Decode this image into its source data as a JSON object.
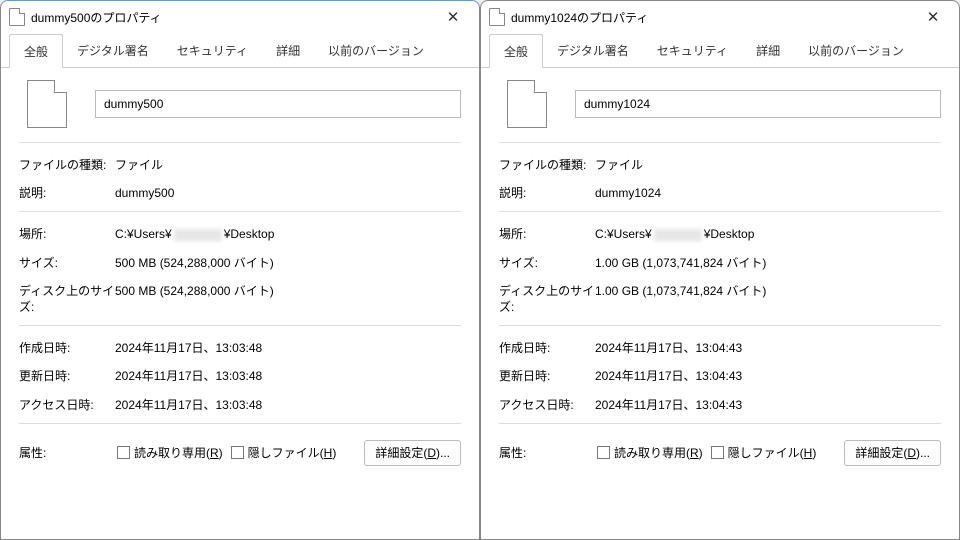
{
  "tabs": {
    "general": "全般",
    "signature": "デジタル署名",
    "security": "セキュリティ",
    "details": "詳細",
    "previous": "以前のバージョン"
  },
  "labels": {
    "filetype": "ファイルの種類:",
    "description": "説明:",
    "location": "場所:",
    "size": "サイズ:",
    "sizeondisk": "ディスク上のサイズ:",
    "created": "作成日時:",
    "modified": "更新日時:",
    "accessed": "アクセス日時:",
    "attributes": "属性:",
    "readonly_pre": "読み取り専用(",
    "readonly_u": "R",
    "readonly_post": ")",
    "hidden_pre": "隠しファイル(",
    "hidden_u": "H",
    "hidden_post": ")",
    "advanced_pre": "詳細設定(",
    "advanced_u": "D",
    "advanced_post": ")..."
  },
  "left": {
    "title": "dummy500のプロパティ",
    "name": "dummy500",
    "filetype": "ファイル",
    "description": "dummy500",
    "location_pre": "C:¥Users¥",
    "location_post": "¥Desktop",
    "size": "500 MB (524,288,000 バイト)",
    "sizeondisk": "500 MB (524,288,000 バイト)",
    "created": "2024年11月17日、13:03:48",
    "modified": "2024年11月17日、13:03:48",
    "accessed": "2024年11月17日、13:03:48"
  },
  "right": {
    "title": "dummy1024のプロパティ",
    "name": "dummy1024",
    "filetype": "ファイル",
    "description": "dummy1024",
    "location_pre": "C:¥Users¥",
    "location_post": "¥Desktop",
    "size": "1.00 GB (1,073,741,824 バイト)",
    "sizeondisk": "1.00 GB (1,073,741,824 バイト)",
    "created": "2024年11月17日、13:04:43",
    "modified": "2024年11月17日、13:04:43",
    "accessed": "2024年11月17日、13:04:43"
  }
}
